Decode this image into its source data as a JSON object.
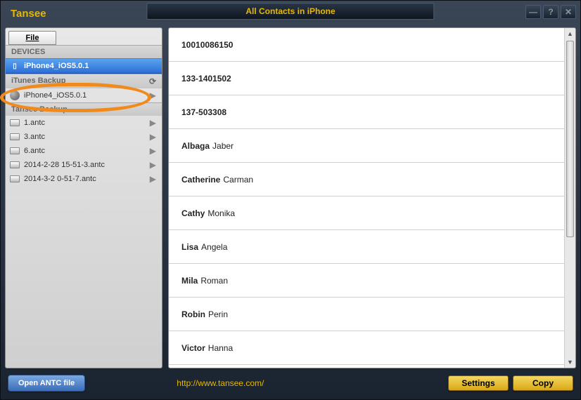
{
  "app_name": "Tansee",
  "title": "All Contacts in iPhone",
  "file_menu": "File",
  "titlebar_buttons": {
    "min": "—",
    "help": "?",
    "close": "✕"
  },
  "sidebar": {
    "sections": [
      {
        "header": "DEVICES",
        "items": [
          {
            "label": "iPhone4_iOS5.0.1",
            "icon": "phone",
            "selected": true,
            "refresh": false,
            "chevron": false
          }
        ]
      },
      {
        "header": "iTunes Backup",
        "refresh": true,
        "items": [
          {
            "label": "iPhone4_iOS5.0.1",
            "icon": "circle",
            "chevron": true
          }
        ]
      },
      {
        "header": "Tansee Backup",
        "items": [
          {
            "label": "1.antc",
            "icon": "drive",
            "chevron": true
          },
          {
            "label": "3.antc",
            "icon": "drive",
            "chevron": true
          },
          {
            "label": "6.antc",
            "icon": "drive",
            "chevron": true
          },
          {
            "label": "2014-2-28 15-51-3.antc",
            "icon": "drive",
            "chevron": true
          },
          {
            "label": "2014-3-2 0-51-7.antc",
            "icon": "drive",
            "chevron": true
          }
        ]
      }
    ]
  },
  "contacts": [
    {
      "first": "10010086150",
      "last": ""
    },
    {
      "first": "133-1401502",
      "last": ""
    },
    {
      "first": "137-503308",
      "last": ""
    },
    {
      "first": "Albaga",
      "last": "Jaber"
    },
    {
      "first": "Catherine",
      "last": "Carman"
    },
    {
      "first": "Cathy",
      "last": "Monika"
    },
    {
      "first": "Lisa",
      "last": "Angela"
    },
    {
      "first": "Mila",
      "last": "Roman"
    },
    {
      "first": "Robin",
      "last": "Perin"
    },
    {
      "first": "Victor",
      "last": "Hanna"
    }
  ],
  "footer": {
    "open_antc": "Open ANTC file",
    "url": "http://www.tansee.com/",
    "settings": "Settings",
    "copy": "Copy"
  }
}
